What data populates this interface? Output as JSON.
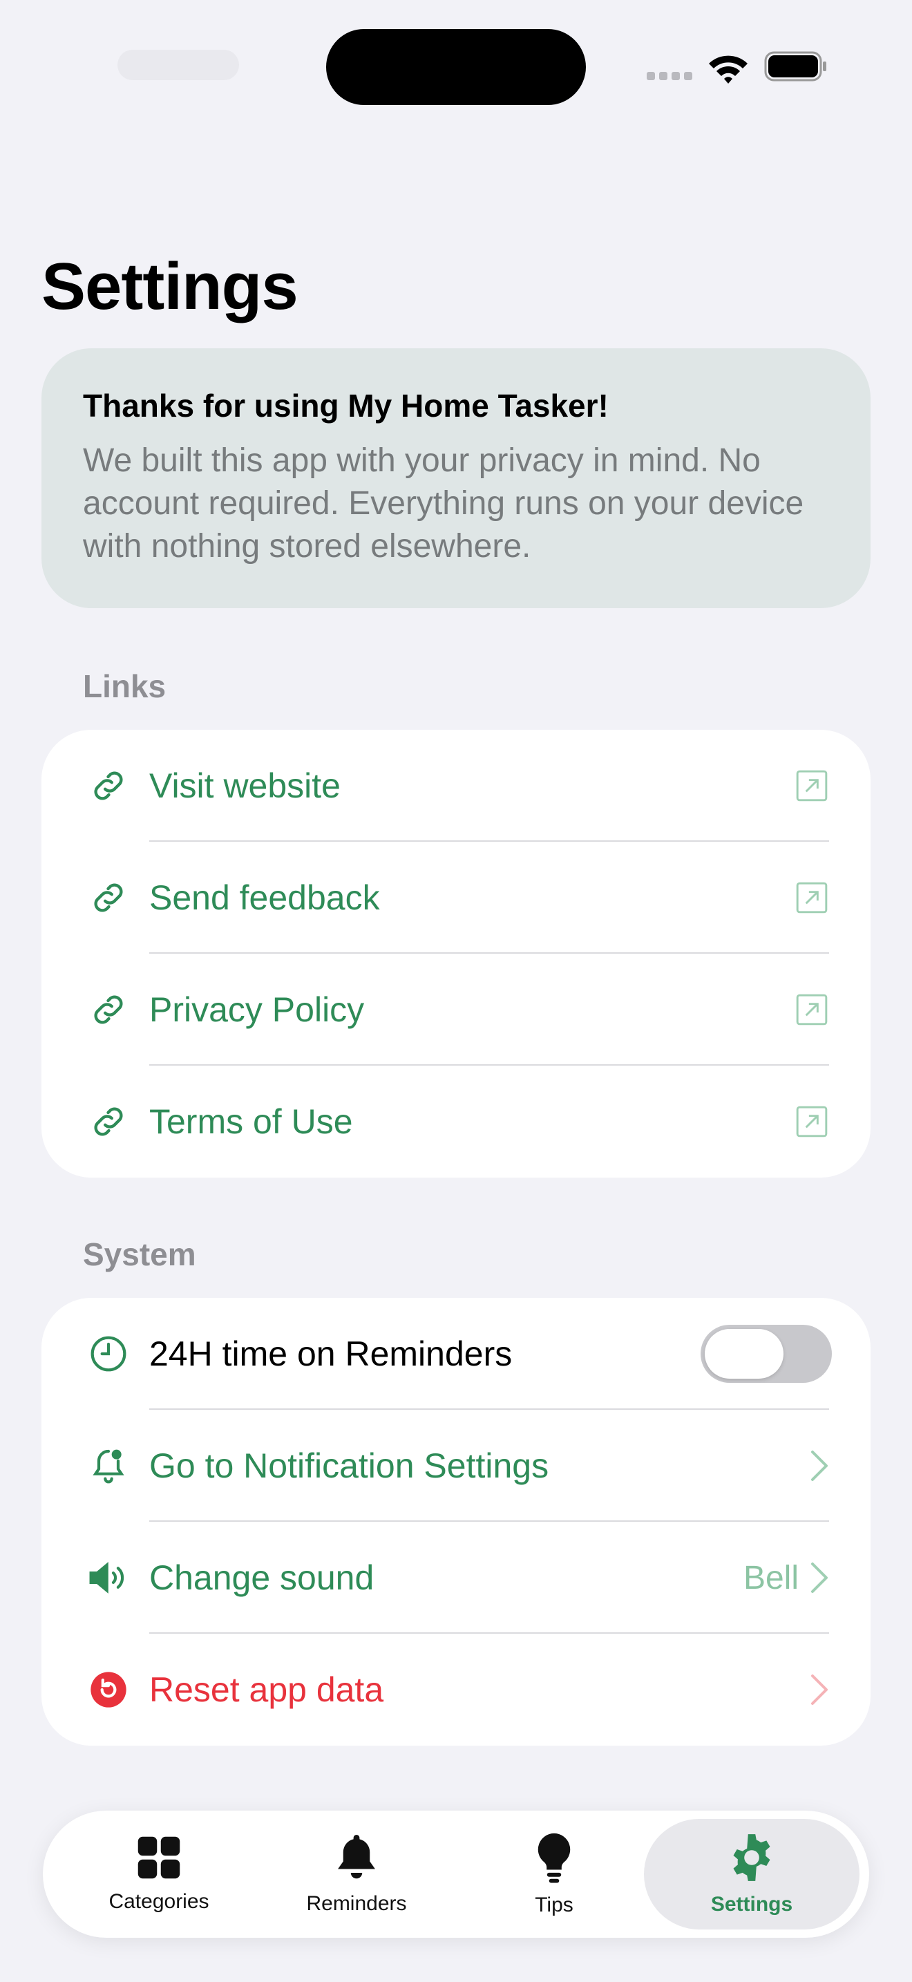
{
  "page": {
    "title": "Settings"
  },
  "banner": {
    "title": "Thanks for using My Home Tasker!",
    "text": "We built this app with your privacy in mind. No account required. Everything runs on your device with nothing stored elsewhere."
  },
  "links": {
    "header": "Links",
    "items": [
      {
        "label": "Visit website",
        "icon": "link-icon"
      },
      {
        "label": "Send feedback",
        "icon": "link-icon"
      },
      {
        "label": "Privacy Policy",
        "icon": "link-icon"
      },
      {
        "label": "Terms of Use",
        "icon": "link-icon"
      }
    ]
  },
  "system": {
    "header": "System",
    "time_24h": {
      "label": "24H time on Reminders",
      "enabled": false
    },
    "notifications": {
      "label": "Go to Notification Settings"
    },
    "sound": {
      "label": "Change sound",
      "value": "Bell"
    },
    "reset": {
      "label": "Reset app data"
    }
  },
  "tabbar": {
    "tabs": [
      {
        "label": "Categories",
        "icon": "grid-icon"
      },
      {
        "label": "Reminders",
        "icon": "bell-icon"
      },
      {
        "label": "Tips",
        "icon": "lightbulb-icon"
      },
      {
        "label": "Settings",
        "icon": "gear-icon",
        "active": true
      }
    ]
  },
  "colors": {
    "accent": "#2e8b57",
    "danger": "#e8323c",
    "background": "#f2f2f7"
  }
}
